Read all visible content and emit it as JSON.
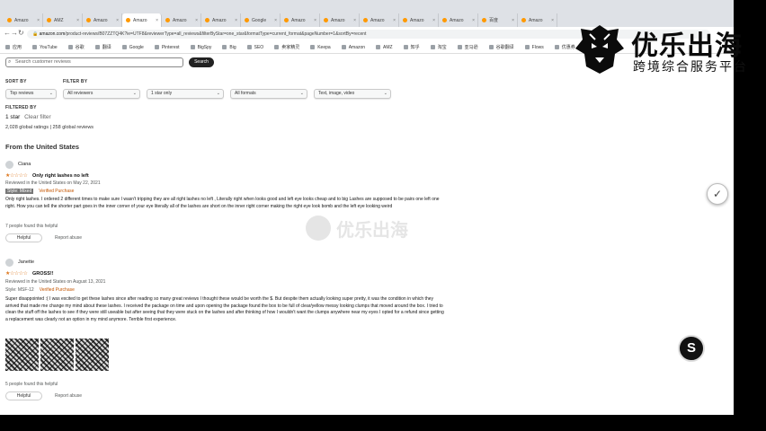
{
  "browser": {
    "tabs": [
      {
        "label": "Amazo"
      },
      {
        "label": "AMZ"
      },
      {
        "label": "Amazo"
      },
      {
        "label": "Amazo",
        "active": true
      },
      {
        "label": "Amazo"
      },
      {
        "label": "Amazo"
      },
      {
        "label": "Google"
      },
      {
        "label": "Amazo"
      },
      {
        "label": "Amazo"
      },
      {
        "label": "Amazo"
      },
      {
        "label": "Amazo"
      },
      {
        "label": "Amazo"
      },
      {
        "label": "百度"
      },
      {
        "label": "Amazo"
      }
    ],
    "url_host": "amazon.com",
    "url_path": "/product-reviews/B07ZZTQ4K?ie=UTF8&reviewerType=all_reviews&filterByStar=one_star&formatType=current_format&pageNumber=1&sortBy=recent",
    "bookmarks": [
      "应用",
      "YouTube",
      "谷歌",
      "翻译",
      "Google",
      "Pinterest",
      "BigSpy",
      "Big",
      "SEO",
      "卖家精灵",
      "Keepa",
      "Amazon",
      "AMZ",
      "知乎",
      "淘宝",
      "亚马逊",
      "谷歌翻译",
      "Flows",
      "优惠券"
    ]
  },
  "search": {
    "placeholder": "Search customer reviews",
    "button": "Search"
  },
  "filters": {
    "sort_label": "SORT BY",
    "filter_label": "FILTER BY",
    "sort_value": "Top reviews",
    "reviewer_value": "All reviewers",
    "star_value": "1 star only",
    "format_value": "All formats",
    "media_value": "Text, image, video",
    "filtered_by_label": "FILTERED BY",
    "filtered_value": "1 star",
    "clear_label": "Clear filter",
    "counts": "2,028 global ratings | 258 global reviews"
  },
  "section_title": "From the United States",
  "reviews": [
    {
      "author": "Ciana",
      "stars": "★☆☆☆☆",
      "title": "Only right lashes no left",
      "date": "Reviewed in the United States on May 22, 2021",
      "format": "Style: Mixed",
      "verified": "Verified Purchase",
      "body": "Only right lashes. I ordered 2 different times to make sure I wasn't tripping they are all right lashes no left , Literally right when looks good and left eye looks cheap and to big Lashes are supposed to be pairs one left one right. How you can tell the shorter part goes in the inner corner of your eye literally all of the lashes are short on the inner right corner making the right eye look bomb and the left eye looking weird",
      "helpful_text": "7 people found this helpful",
      "helpful_btn": "Helpful",
      "report": "Report abuse"
    },
    {
      "author": "Janette",
      "stars": "★☆☆☆☆",
      "title": "GROSS!!",
      "date": "Reviewed in the United States on August 13, 2021",
      "format": "Style: MSF-12",
      "verified": "Verified Purchase",
      "body": "Super disappointed :( I was excited to get these lashes since after reading so many great reviews I thought these would be worth the $. But despite them actually looking super pretty, it was the condition in which they arrived that made me change my mind about these lashes. I received the package on time and upon opening the package found the box to be full of clear/yellow messy looking clumps that moved around the box. I tried to clean the stuff off the lashes to see if they were still useable but after seeing that they were stuck on the lashes and after thinking of how I wouldn't want the clumps anywhere near my eyes I opted for a refund since getting a replacement was clearly not an option in my mind anymore. Terrible first experience.",
      "helpful_text": "5 people found this helpful",
      "helpful_btn": "Helpful",
      "report": "Report abuse"
    }
  ],
  "watermark_text": "优乐出海",
  "logo": {
    "main": "优乐出海",
    "sub": "跨境综合服务平台"
  },
  "colors": {
    "star": "#de7921",
    "logo_text": "#0b0b0b",
    "page_bg": "#ffffff",
    "frame_bg": "#000000"
  }
}
